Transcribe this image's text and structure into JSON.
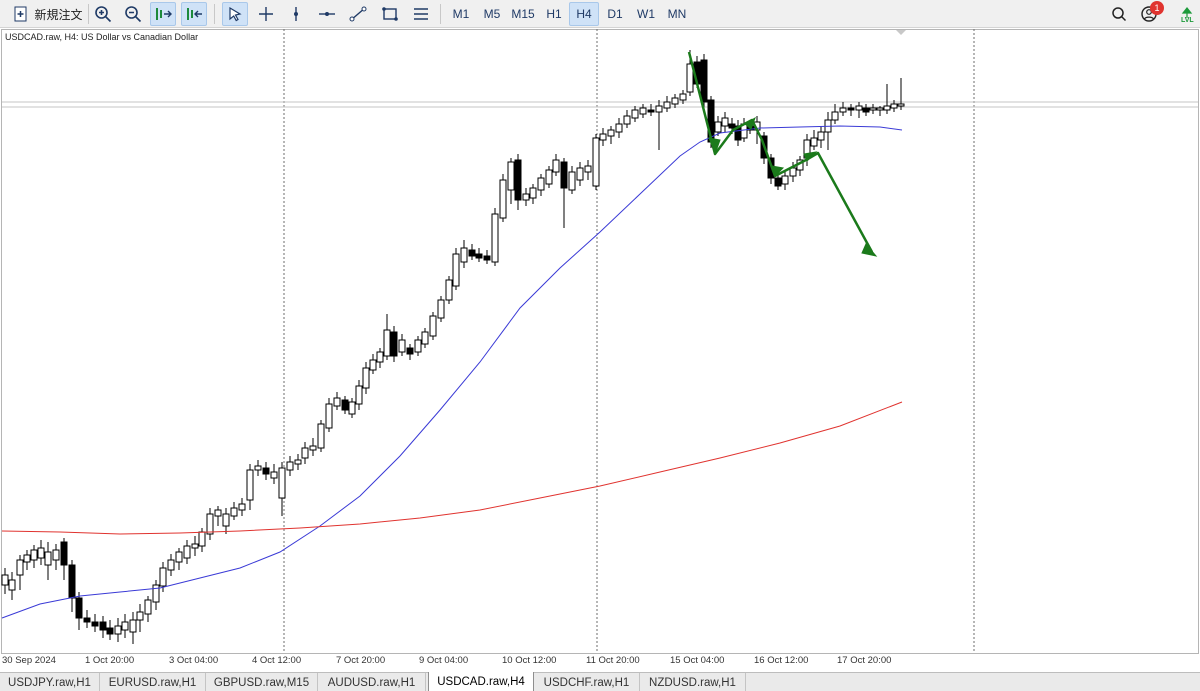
{
  "toolbar": {
    "new_order_label": "新規注文",
    "icons": [
      "new-order-icon",
      "zoom-in-icon",
      "zoom-out-icon",
      "autoscroll-icon",
      "chart-shift-icon",
      "cursor-icon",
      "crosshair-icon",
      "vertical-line-icon",
      "horizontal-line-icon",
      "trendline-icon",
      "rectangle-icon",
      "fibonacci-icon",
      "search-icon",
      "notification-icon",
      "lvl-icon"
    ],
    "timeframes": [
      "M1",
      "M5",
      "M15",
      "H1",
      "H4",
      "D1",
      "W1",
      "MN"
    ],
    "active_timeframe": "H4",
    "notification_count": "1",
    "lvl_label": "LVL"
  },
  "chart": {
    "title": "USDCAD.raw, H4:  US Dollar vs Canadian Dollar",
    "time_labels": [
      "30 Sep 2024",
      "1 Oct 20:00",
      "3 Oct 04:00",
      "4 Oct 12:00",
      "7 Oct 20:00",
      "9 Oct 04:00",
      "10 Oct 12:00",
      "11 Oct 20:00",
      "15 Oct 04:00",
      "16 Oct 12:00",
      "17 Oct 20:00"
    ],
    "colors": {
      "bull": "#ffffff",
      "bear": "#000000",
      "wick": "#000000",
      "ma_fast": "#3a3ad6",
      "ma_slow": "#e0332f",
      "annotation": "#1b7a1b",
      "grid": "#6e6e6e"
    }
  },
  "tabs": [
    "USDJPY.raw,H1",
    "EURUSD.raw,H1",
    "GBPUSD.raw,M15",
    "AUDUSD.raw,H1",
    "USDCAD.raw,H4",
    "USDCHF.raw,H1",
    "NZDUSD.raw,H1"
  ],
  "active_tab": "USDCAD.raw,H4"
}
